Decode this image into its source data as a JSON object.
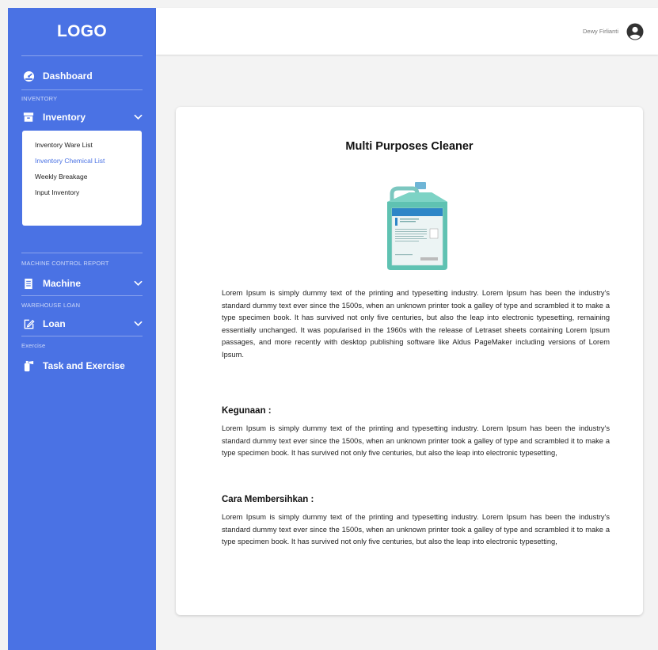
{
  "sidebar": {
    "logo": "LOGO",
    "dashboard": {
      "label": "Dashboard",
      "icon": "speedometer-icon"
    },
    "sections": {
      "inventory": "INVENTORY",
      "machine_control": "MACHINE CONTROL REPORT",
      "warehouse_loan": "WAREHOUSE LOAN",
      "exercise": "Exercise"
    },
    "inventory": {
      "label": "Inventory",
      "icon": "archive-box-icon",
      "submenu": [
        {
          "label": "Inventory Ware List",
          "active": false
        },
        {
          "label": "Inventory Chemical List",
          "active": true
        },
        {
          "label": "Weekly Breakage",
          "active": false
        },
        {
          "label": "Input Inventory",
          "active": false
        }
      ]
    },
    "machine": {
      "label": "Machine",
      "icon": "document-icon"
    },
    "loan": {
      "label": "Loan",
      "icon": "edit-icon"
    },
    "task": {
      "label": "Task and Exercise",
      "icon": "fire-extinguisher-icon"
    }
  },
  "topbar": {
    "username": "Dewy Firlianti",
    "avatar_icon": "user-circle-icon"
  },
  "content": {
    "title": "Multi Purposes Cleaner",
    "description": "Lorem Ipsum is simply dummy text of the printing and typesetting industry. Lorem Ipsum has been the industry's standard dummy text ever since the 1500s, when an unknown printer took a galley of type and scrambled it to make a type specimen book. It has survived not only five centuries, but also the leap into electronic typesetting, remaining essentially unchanged. It was popularised in the 1960s with the release of Letraset sheets containing Lorem Ipsum passages, and more recently with desktop publishing software like Aldus PageMaker including versions of Lorem Ipsum.",
    "usage_heading": "Kegunaan :",
    "usage_text": "Lorem Ipsum is simply dummy text of the printing and typesetting industry. Lorem Ipsum has been the industry's standard dummy text ever since the 1500s, when an unknown printer took a galley of type and scrambled it to make a type specimen book. It has survived not only five centuries, but also the leap into electronic typesetting,",
    "cleaning_heading": "Cara Membersihkan :",
    "cleaning_text": "Lorem Ipsum is simply dummy text of the printing and typesetting industry. Lorem Ipsum has been the industry's standard dummy text ever since the 1500s, when an unknown printer took a galley of type and scrambled it to make a type specimen book. It has survived not only five centuries, but also the leap into electronic typesetting,"
  },
  "colors": {
    "sidebar_bg": "#4a72e4",
    "active_link": "#4a72e4",
    "page_bg": "#f3f3f3",
    "card_bg": "#ffffff"
  }
}
